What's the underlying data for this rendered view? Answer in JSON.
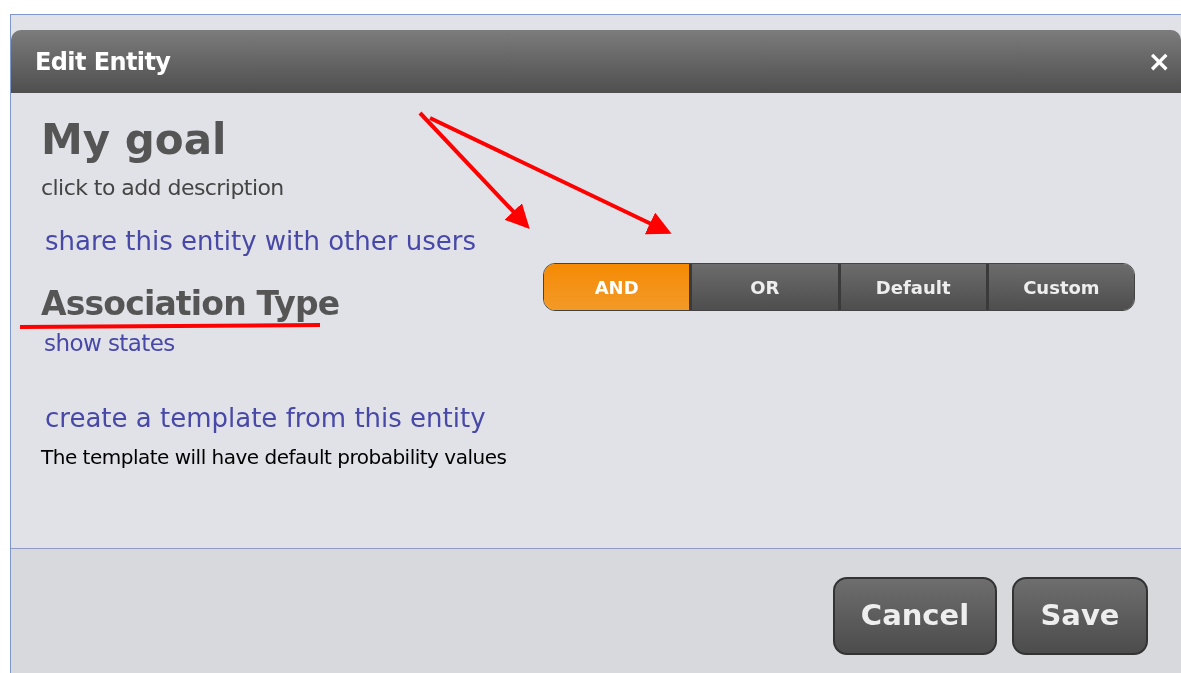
{
  "dialog": {
    "title": "Edit Entity",
    "close": "×"
  },
  "entity": {
    "name": "My goal",
    "description_hint": "click to add description"
  },
  "share_link": "share this entity with other users",
  "association": {
    "label": "Association Type",
    "show_states": "show states",
    "options": [
      {
        "label": "AND",
        "selected": true
      },
      {
        "label": "OR",
        "selected": false
      },
      {
        "label": "Default",
        "selected": false
      },
      {
        "label": "Custom",
        "selected": false
      }
    ]
  },
  "template": {
    "link": "create a template from this entity",
    "note": "The template will have default probability values"
  },
  "buttons": [
    "Cancel",
    "Save"
  ]
}
